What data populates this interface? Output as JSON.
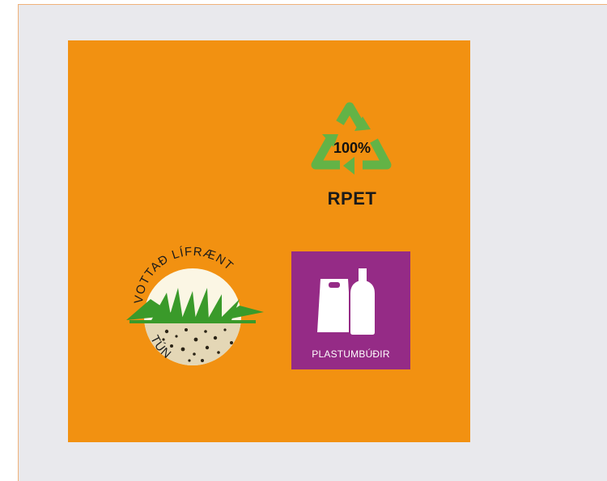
{
  "colors": {
    "background": "#e9e9ed",
    "panel": "#f29111",
    "recycle_green": "#63b346",
    "badge_purple": "#952b86"
  },
  "recycle_badge": {
    "percent": "100%",
    "label": "RPET",
    "icon": "recycle-arrows-icon"
  },
  "organic_seal": {
    "arc_text": "VOTTAÐ LÍFRÆNT",
    "bottom_text": "TÚN",
    "icon": "grass-soil-seal-icon"
  },
  "packaging_badge": {
    "label": "PLASTUMBÚÐIR",
    "icon": "bag-and-bottle-icon"
  }
}
